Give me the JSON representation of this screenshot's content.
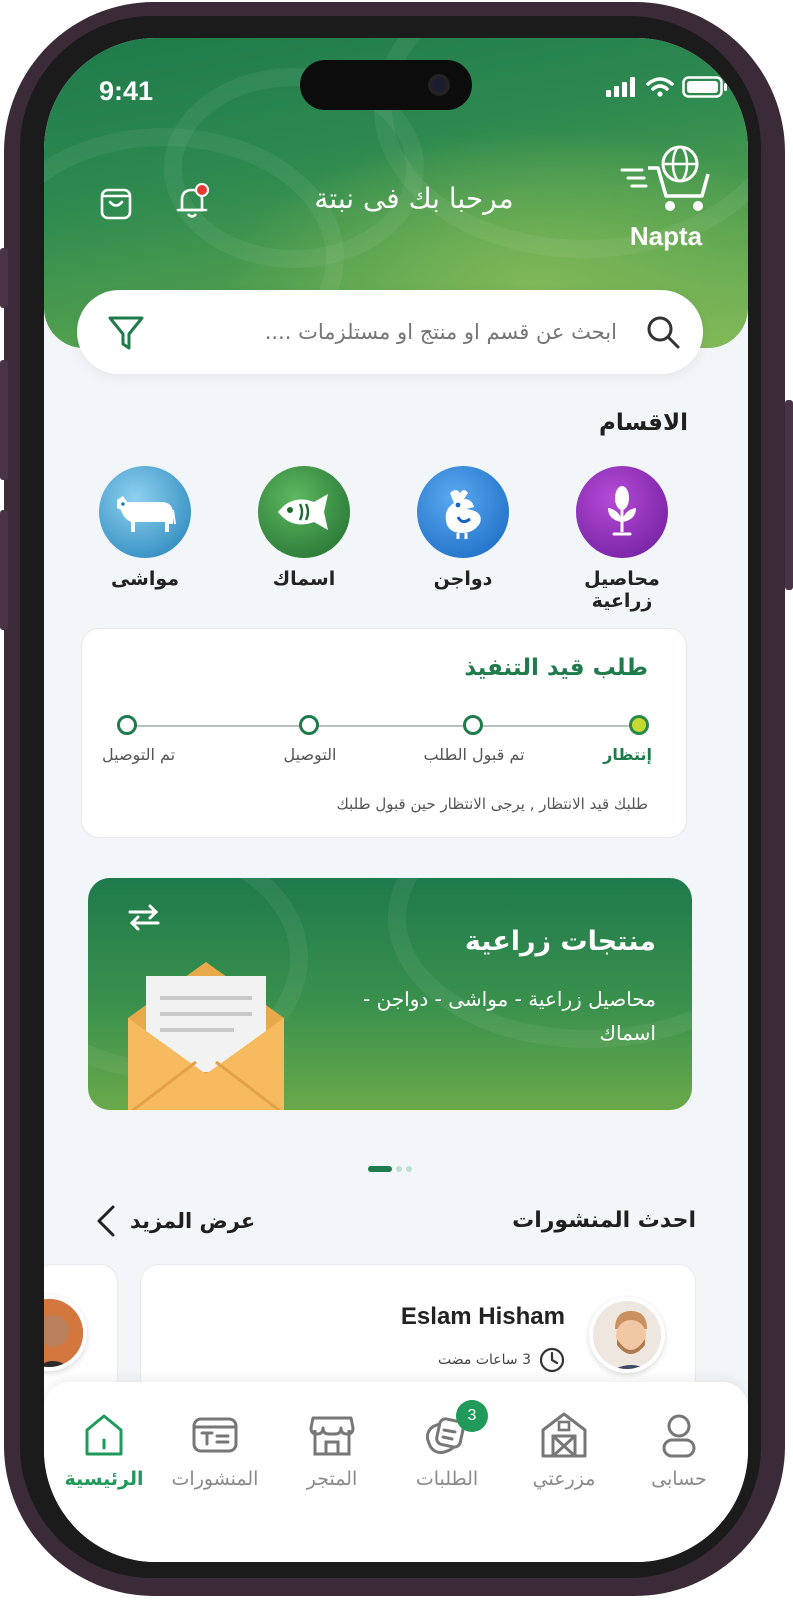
{
  "status_bar": {
    "time": "9:41"
  },
  "header": {
    "logo_text": "Napta",
    "welcome": "مرحبا بك فى نبتة"
  },
  "search": {
    "placeholder": "ابحث عن قسم او منتج او مستلزمات ...."
  },
  "categories": {
    "title": "الاقسام",
    "items": [
      {
        "label": "محاصيل زراعية",
        "icon": "sprout-icon",
        "color": "#7b1fa2"
      },
      {
        "label": "دواجن",
        "icon": "chicken-icon",
        "color": "#1e88e5"
      },
      {
        "label": "اسماك",
        "icon": "fish-icon",
        "color": "#2e7d32"
      },
      {
        "label": "مواشى",
        "icon": "cow-icon",
        "color": "#2a86c4"
      }
    ]
  },
  "order": {
    "title": "طلب قيد التنفيذ",
    "steps": [
      "إنتظار",
      "تم قبول الطلب",
      "التوصيل",
      "تم التوصيل"
    ],
    "active_step": 0,
    "note": "طلبك قيد الانتظار , يرجى الانتظار حين قبول طلبك"
  },
  "banner": {
    "title": "منتجات زراعية",
    "subtitle": "محاصيل زراعية - مواشى - دواجن - اسماك",
    "page_count": 3,
    "active_page": 0
  },
  "posts": {
    "title": "احدث المنشورات",
    "see_more": "عرض المزيد",
    "items": [
      {
        "name": "Eslam Hisham",
        "time": "3 ساعات مضت"
      }
    ]
  },
  "bottom_nav": {
    "items": [
      {
        "label": "الرئيسية",
        "icon": "home-icon",
        "active": true
      },
      {
        "label": "المنشورات",
        "icon": "posts-icon"
      },
      {
        "label": "المتجر",
        "icon": "store-icon"
      },
      {
        "label": "الطلبات",
        "icon": "orders-icon",
        "badge": "3"
      },
      {
        "label": "مزرعتي",
        "icon": "farm-icon"
      },
      {
        "label": "حسابى",
        "icon": "user-icon"
      }
    ]
  },
  "colors": {
    "primary": "#1f7a4c",
    "accent_green": "#1f9a5a",
    "active_dot": "#c6d932",
    "notification_dot": "#e53935"
  }
}
